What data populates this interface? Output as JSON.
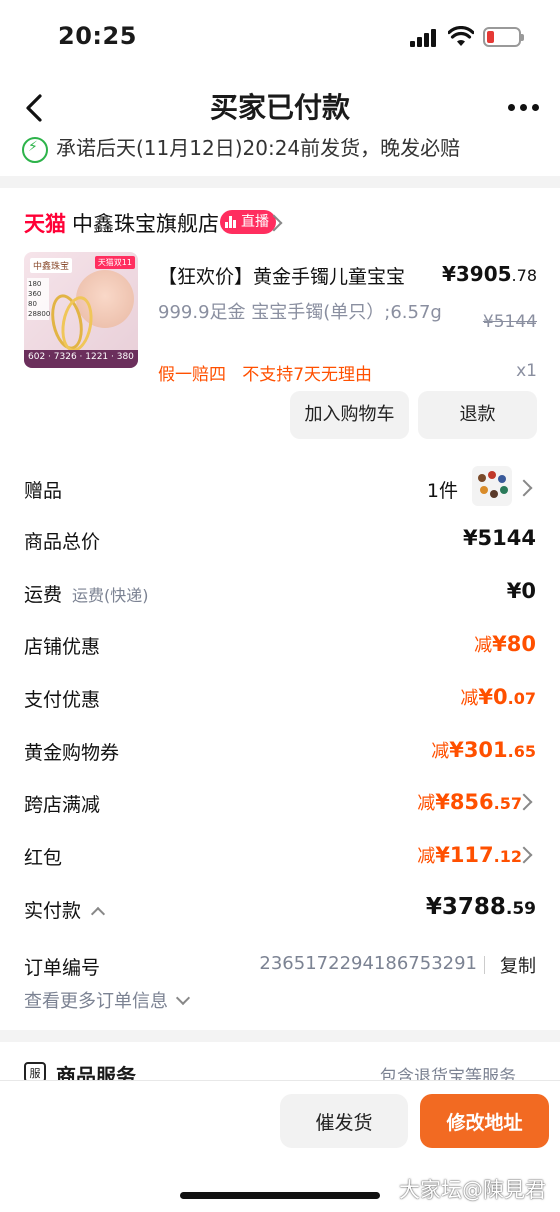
{
  "status_bar": {
    "time": "20:25"
  },
  "nav": {
    "title": "买家已付款"
  },
  "promise": {
    "text": "承诺后天(11月12日)20:24前发货，晚发必赔"
  },
  "store": {
    "platform": "天猫",
    "name": "中鑫珠宝旗舰店",
    "live_label": "直播"
  },
  "product": {
    "thumb_logo": "中鑫珠宝",
    "thumb_tag": "天猫双11",
    "thumb_strip": "602 · 7326 · 1221 · 380",
    "thumb_side": "180 360 80 28800",
    "title": "【狂欢价】黄金手镯儿童宝宝",
    "spec": "999.9足金 宝宝手镯(单只）;6.57g",
    "price_main": "¥3905",
    "price_decimal": ".78",
    "original_price": "¥5144",
    "tag_1": "假一赔四",
    "tag_2": "不支持7天无理由",
    "qty": "x1",
    "btn_cart": "加入购物车",
    "btn_refund": "退款"
  },
  "rows": {
    "gift_label": "赠品",
    "gift_count": "1件",
    "total_label": "商品总价",
    "total_value": "¥5144",
    "shipping_label": "运费",
    "shipping_sub": "运费(快递)",
    "shipping_value": "¥0",
    "store_discount_label": "店铺优惠",
    "store_discount_prefix": "减",
    "store_discount_value": "¥80",
    "pay_discount_label": "支付优惠",
    "pay_discount_prefix": "减",
    "pay_discount_main": "¥0",
    "pay_discount_decimal": ".07",
    "gold_coupon_label": "黄金购物券",
    "gold_coupon_prefix": "减",
    "gold_coupon_main": "¥301",
    "gold_coupon_decimal": ".65",
    "cross_store_label": "跨店满减",
    "cross_store_prefix": "减",
    "cross_store_main": "¥856",
    "cross_store_decimal": ".57",
    "red_packet_label": "红包",
    "red_packet_prefix": "减",
    "red_packet_main": "¥117",
    "red_packet_decimal": ".12",
    "paid_label": "实付款",
    "paid_main": "¥3788",
    "paid_decimal": ".59",
    "order_label": "订单编号",
    "order_no": "2365172294186753291",
    "copy_label": "复制",
    "more_info": "查看更多订单信息"
  },
  "service": {
    "icon_char": "服",
    "title": "商品服务",
    "subtitle": "包含退货宝等服务"
  },
  "bottom": {
    "btn_urge": "催发货",
    "btn_address": "修改地址"
  },
  "watermark": "大家坛@陳見君",
  "colors": {
    "accent": "#ff5000",
    "primary_button": "#f26a22",
    "tmall_red": "#ff0036",
    "live_pink": "#ff2e5f"
  }
}
